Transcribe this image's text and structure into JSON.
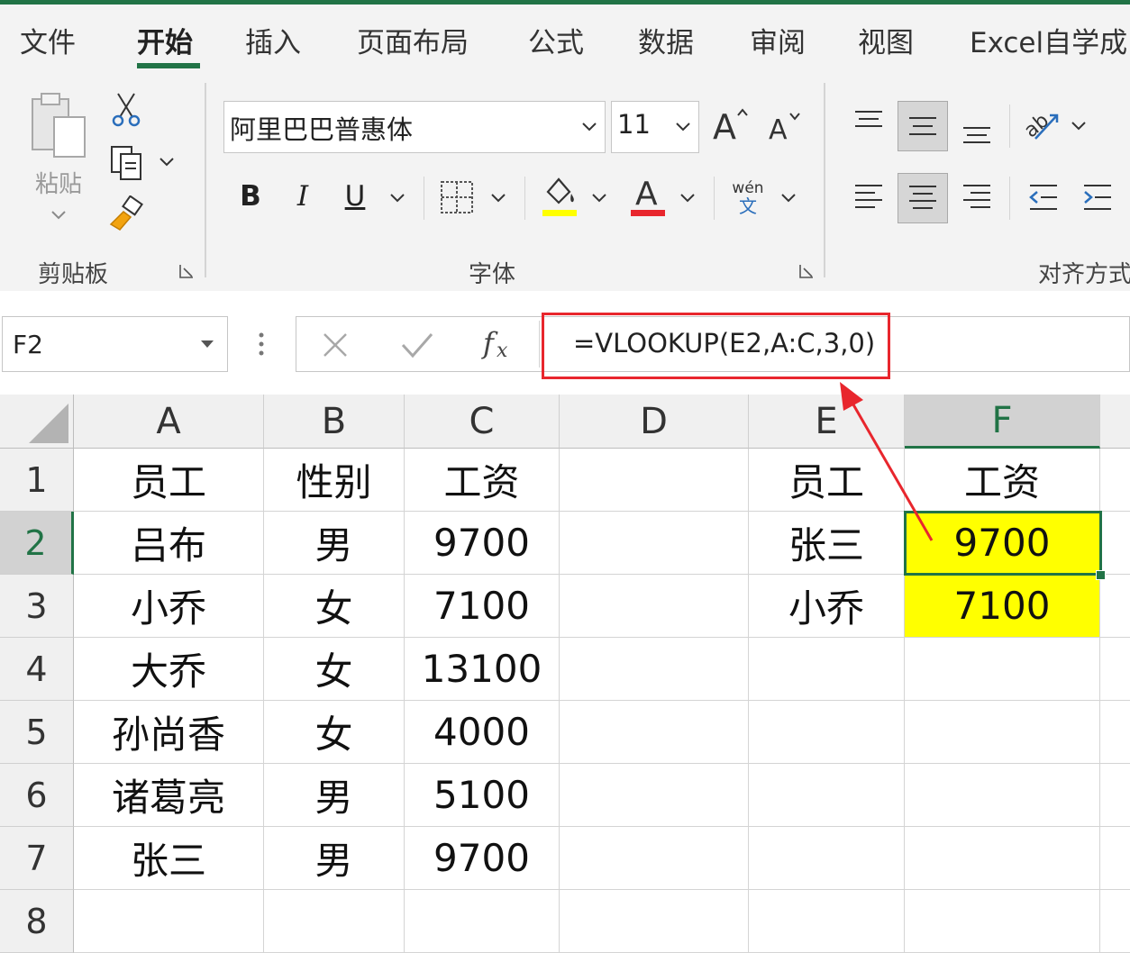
{
  "ribbon": {
    "tabs": [
      "文件",
      "开始",
      "插入",
      "页面布局",
      "公式",
      "数据",
      "审阅",
      "视图",
      "Excel自学成"
    ],
    "active_tab": "开始",
    "clipboard": {
      "paste_label": "粘贴",
      "group_label": "剪贴板"
    },
    "font": {
      "font_name": "阿里巴巴普惠体",
      "font_size": "11",
      "bold": "B",
      "italic": "I",
      "underline": "U",
      "phonetic_top": "wén",
      "phonetic_bottom": "文",
      "group_label": "字体",
      "highlight_color": "#ffff00",
      "font_color": "#e8262d"
    },
    "alignment": {
      "group_label": "对齐方式"
    }
  },
  "formula_bar": {
    "name_box": "F2",
    "fx": "fx",
    "formula": "=VLOOKUP(E2,A:C,3,0)"
  },
  "sheet": {
    "columns": [
      "A",
      "B",
      "C",
      "D",
      "E",
      "F"
    ],
    "selected_column": "F",
    "rows": [
      "1",
      "2",
      "3",
      "4",
      "5",
      "6",
      "7",
      "8"
    ],
    "selected_row": "2",
    "cells": {
      "A1": "员工",
      "B1": "性别",
      "C1": "工资",
      "E1": "员工",
      "F1": "工资",
      "A2": "吕布",
      "B2": "男",
      "C2": "9700",
      "E2": "张三",
      "F2": "9700",
      "A3": "小乔",
      "B3": "女",
      "C3": "7100",
      "E3": "小乔",
      "F3": "7100",
      "A4": "大乔",
      "B4": "女",
      "C4": "13100",
      "A5": "孙尚香",
      "B5": "女",
      "C5": "4000",
      "A6": "诸葛亮",
      "B6": "男",
      "C6": "5100",
      "A7": "张三",
      "B7": "男",
      "C7": "9700"
    },
    "highlight_fill": "#ffff00",
    "accent": "#217346",
    "annotation_color": "#e8262d"
  }
}
